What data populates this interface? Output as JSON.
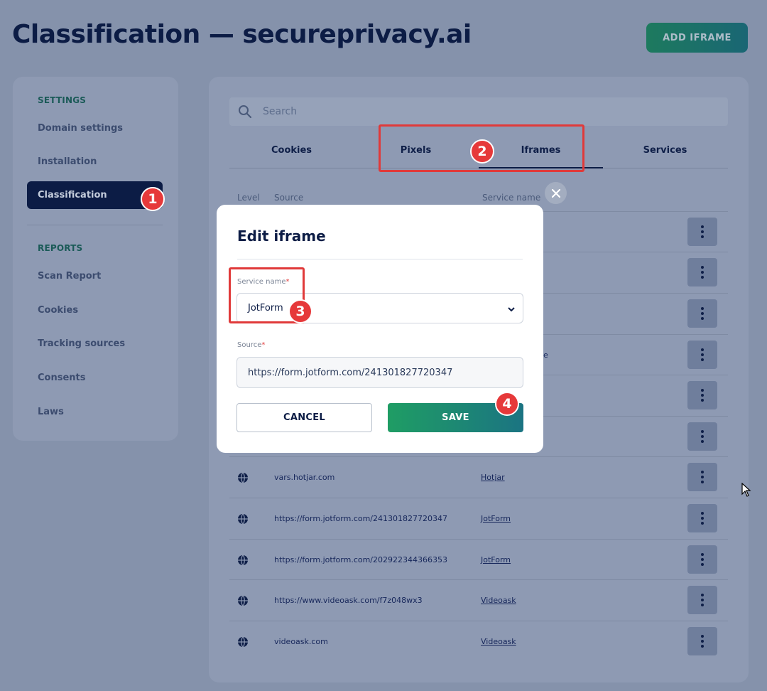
{
  "header": {
    "title": "Classification — secureprivacy.ai",
    "add_button": "ADD IFRAME"
  },
  "sidebar": {
    "settings_heading": "SETTINGS",
    "settings_items": [
      "Domain settings",
      "Installation",
      "Classification"
    ],
    "reports_heading": "REPORTS",
    "reports_items": [
      "Scan Report",
      "Cookies",
      "Tracking sources",
      "Consents",
      "Laws"
    ],
    "active_item": "Classification"
  },
  "search": {
    "placeholder": "Search"
  },
  "tabs": [
    "Cookies",
    "Pixels",
    "Iframes",
    "Services"
  ],
  "active_tab": "Iframes",
  "table": {
    "headers": {
      "level": "Level",
      "source": "Source",
      "service": "Service name"
    },
    "rows": [
      {
        "source": "vars.hotjar.com",
        "service": "Hotjar"
      },
      {
        "source": "https://form.jotform.com/241301827720347",
        "service": "JotForm"
      },
      {
        "source": "https://form.jotform.com/202922344366353",
        "service": "JotForm"
      },
      {
        "source": "https://www.videoask.com/f7z048wx3",
        "service": "Videoask"
      },
      {
        "source": "videoask.com",
        "service": "Videoask"
      }
    ],
    "partial_text": "e"
  },
  "modal": {
    "title": "Edit iframe",
    "service_label": "Service name",
    "service_value": "JotForm",
    "source_label": "Source",
    "source_value": "https://form.jotform.com/241301827720347",
    "required_mark": "*",
    "cancel": "CANCEL",
    "save": "SAVE"
  },
  "annotations": [
    "1",
    "2",
    "3",
    "4"
  ],
  "colors": {
    "accent": "#e6393a",
    "navy": "#0c1c45",
    "green": "#1f9d64"
  }
}
